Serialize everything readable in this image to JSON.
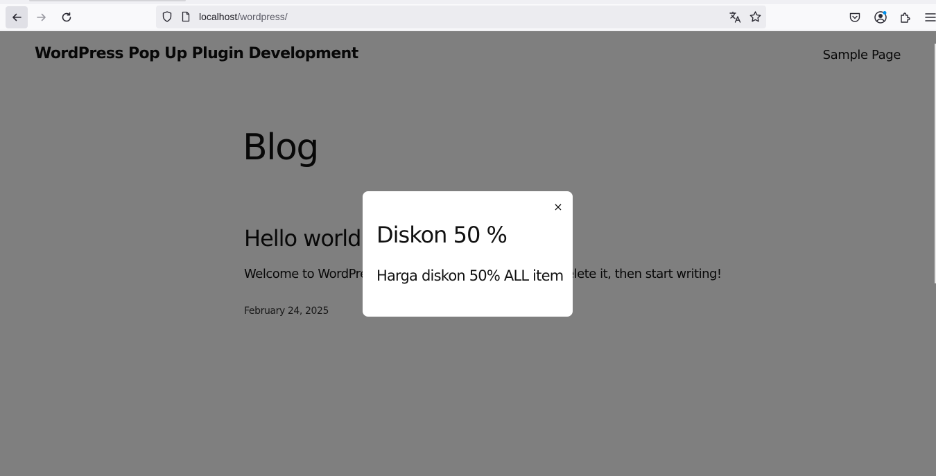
{
  "browser": {
    "url_host": "localhost",
    "url_path": "/wordpress/"
  },
  "site": {
    "title": "WordPress Pop Up Plugin Development",
    "nav": [
      "Sample Page"
    ]
  },
  "page": {
    "heading": "Blog",
    "post": {
      "title": "Hello world!",
      "excerpt": "Welcome to WordPress. This is your first post. Edit or delete it, then start writing!",
      "date": "February 24, 2025"
    }
  },
  "popup": {
    "close_glyph": "×",
    "title": "Diskon 50 %",
    "text": "Harga diskon 50% ALL item"
  },
  "colors": {
    "overlay": "rgba(0,0,0,0.5)",
    "popup_bg": "#ffffff",
    "text": "#111111"
  }
}
